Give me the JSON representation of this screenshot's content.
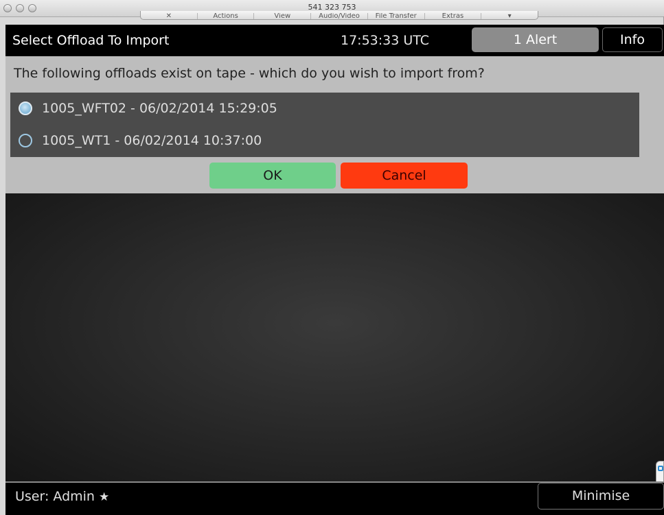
{
  "window": {
    "title": "541 323 753",
    "toolbar": [
      {
        "label": "Actions"
      },
      {
        "label": "View"
      },
      {
        "label": "Audio/Video"
      },
      {
        "label": "File Transfer"
      },
      {
        "label": "Extras"
      }
    ]
  },
  "header": {
    "title": "Select Offload To Import",
    "clock": "17:53:33 UTC",
    "alert_label": "1 Alert",
    "info_label": "Info"
  },
  "dialog": {
    "prompt": "The following offloads exist on tape - which do you wish to import from?",
    "options": [
      {
        "label": "1005_WFT02 - 06/02/2014 15:29:05",
        "selected": true
      },
      {
        "label": "1005_WT1 - 06/02/2014 10:37:00",
        "selected": false
      }
    ],
    "ok_label": "OK",
    "cancel_label": "Cancel"
  },
  "footer": {
    "user_label": "User: Admin",
    "user_icon": "star-icon",
    "minimise_label": "Minimise"
  },
  "colors": {
    "ok": "#6fcf8a",
    "cancel": "#ff3a10",
    "radio_selected": "#8fc0de"
  }
}
